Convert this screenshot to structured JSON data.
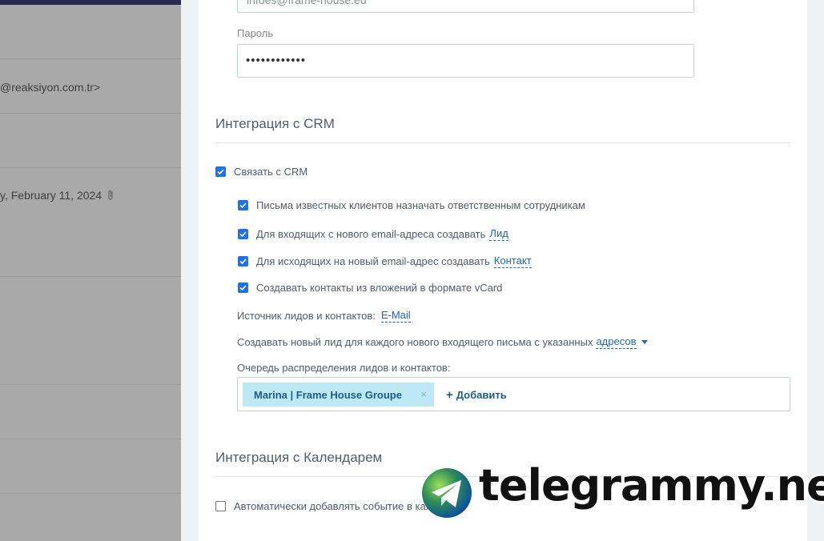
{
  "background_list": {
    "row1_text": "@reaksiyon.com.tr>",
    "row2_text": "y, February 11, 2024"
  },
  "mailbox": {
    "email_value": "infoes@frame-house.eu",
    "password_label": "Пароль",
    "password_value": "••••••••••••"
  },
  "crm": {
    "title": "Интеграция с CRM",
    "link_crm_label": "Связать с CRM",
    "link_crm_checked": true,
    "options": [
      {
        "label": "Письма известных клиентов назначать ответственным сотрудникам",
        "checked": true,
        "link": ""
      },
      {
        "label": "Для входящих с нового email-адреса создавать",
        "checked": true,
        "link": "Лид"
      },
      {
        "label": "Для исходящих на новый email-адрес создавать",
        "checked": true,
        "link": "Контакт"
      },
      {
        "label": "Создавать контакты из вложений в формате vCard",
        "checked": true,
        "link": ""
      }
    ],
    "source_label": "Источник лидов и контактов:",
    "source_value": "E-Mail",
    "new_lead_label": "Создавать новый лид для каждого нового входящего письма с указанных",
    "new_lead_link": "адресов",
    "queue_label": "Очередь распределения лидов и контактов:",
    "queue_tag": "Marina | Frame House Groupe",
    "queue_tag_remove": "×",
    "queue_add": "Добавить"
  },
  "calendar": {
    "title": "Интеграция с Календарем",
    "auto_add_label": "Автоматически добавлять событие в календарь",
    "auto_add_checked": false
  },
  "watermark": {
    "text": "telegrammy.net"
  },
  "colors": {
    "accent": "#1a73e8",
    "link": "#2067b0",
    "tag_bg": "#bde8f6"
  }
}
